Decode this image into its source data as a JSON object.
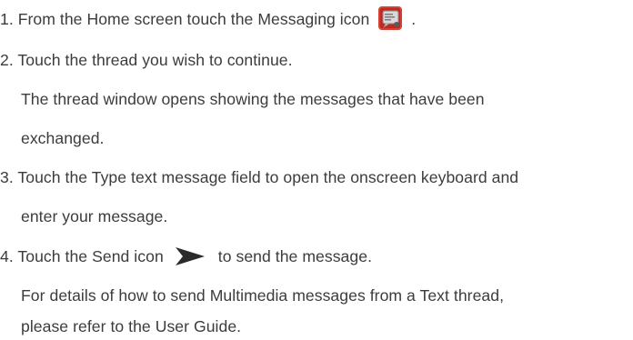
{
  "steps": [
    {
      "lines": [
        {
          "before": "1. From the Home screen touch the Messaging icon",
          "after": "."
        }
      ],
      "icon": "messaging-icon"
    },
    {
      "lines": [
        "2. Touch the thread you wish to continue.",
        "The thread window opens showing the messages that have been",
        "exchanged."
      ]
    },
    {
      "lines": [
        "3. Touch the Type text message field to open the onscreen keyboard and",
        "enter your message."
      ]
    },
    {
      "lines": [
        {
          "before": "4. Touch the Send icon",
          "after": "to send the message."
        },
        "For details of how to send Multimedia messages from a Text thread,",
        "please refer to the User Guide."
      ],
      "icon": "send-arrow-icon"
    }
  ],
  "colors": {
    "text": "#3c3c3c",
    "messaging_icon_bg": "#c2281e",
    "send_icon": "#2b2b2b"
  }
}
